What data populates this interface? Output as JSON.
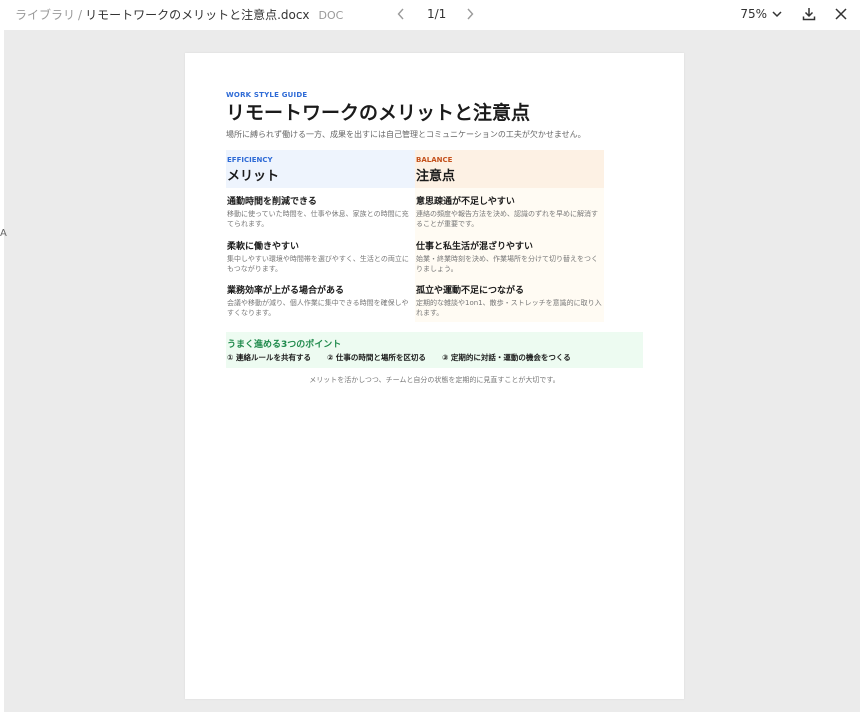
{
  "breadcrumb": {
    "library": "ライブラリ",
    "separator": "/",
    "file_name": "リモートワークのメリットと注意点.docx",
    "file_type": "DOC"
  },
  "pager": {
    "current": "1/1"
  },
  "zoom": {
    "level": "75%"
  },
  "icons": {
    "prev": "chevron-left-icon",
    "next": "chevron-right-icon",
    "zoom_dropdown": "chevron-down-icon",
    "download": "download-icon",
    "close": "close-icon"
  },
  "edge_mark": "A",
  "doc": {
    "eyebrow": "WORK STYLE GUIDE",
    "title": "リモートワークのメリットと注意点",
    "subtitle": "場所に縛られず働ける一方、成果を出すには自己管理とコミュニケーションの工夫が欠かせません。",
    "merits": {
      "tag": "EFFICIENCY",
      "title": "メリット",
      "items": [
        {
          "title": "通勤時間を削減できる",
          "body": "移動に使っていた時間を、仕事や休息、家族との時間に充てられます。"
        },
        {
          "title": "柔軟に働きやすい",
          "body": "集中しやすい環境や時間帯を選びやすく、生活との両立にもつながります。"
        },
        {
          "title": "業務効率が上がる場合がある",
          "body": "会議や移動が減り、個人作業に集中できる時間を確保しやすくなります。"
        }
      ]
    },
    "cautions": {
      "tag": "BALANCE",
      "title": "注意点",
      "items": [
        {
          "title": "意思疎通が不足しやすい",
          "body": "連絡の頻度や報告方法を決め、認識のずれを早めに解消することが重要です。"
        },
        {
          "title": "仕事と私生活が混ざりやすい",
          "body": "始業・終業時刻を決め、作業場所を分けて切り替えをつくりましょう。"
        },
        {
          "title": "孤立や運動不足につながる",
          "body": "定期的な雑談や1on1、散歩・ストレッチを意識的に取り入れます。"
        }
      ]
    },
    "tips": {
      "title": "うまく進める3つのポイント",
      "points": [
        "① 連絡ルールを共有する",
        "② 仕事の時間と場所を区切る",
        "③ 定期的に対話・運動の機会をつくる"
      ]
    },
    "footnote": "メリットを活かしつつ、チームと自分の状態を定期的に見直すことが大切です。"
  }
}
